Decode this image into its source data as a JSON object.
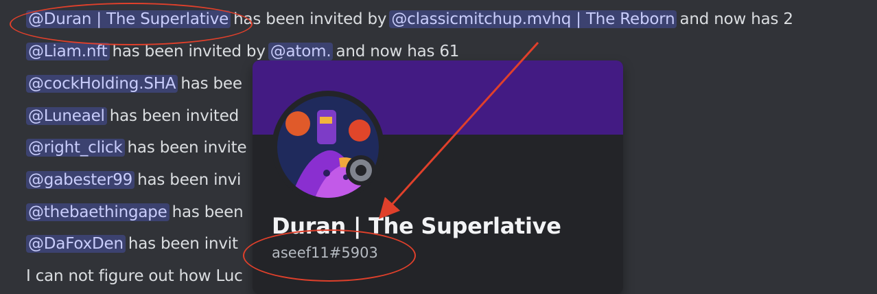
{
  "messages": [
    {
      "mention": "@Duran | The Superlative",
      "text1": "has been invited by",
      "mention2": "@classicmitchup.mvhq | The Reborn",
      "text2": "and now has 2"
    },
    {
      "mention": "@Liam.nft",
      "text1": "has been invited by",
      "mention2": "@atom.",
      "text2": "and now has 61"
    },
    {
      "mention": "@cockHolding.SHA",
      "text1": "has bee"
    },
    {
      "mention": "@Luneael",
      "text1": "has been invited"
    },
    {
      "mention": "@right_click",
      "text1": "has been invite"
    },
    {
      "mention": "@gabester99",
      "text1": "has been invi"
    },
    {
      "mention": "@thebaethingape",
      "text1": "has been"
    },
    {
      "mention": "@DaFoxDen",
      "text1": "has been invit"
    },
    {
      "text1": "I can not figure out how Luc"
    }
  ],
  "popout": {
    "display_name": "Duran | The Superlative",
    "username": "aseef11#5903",
    "banner_color": "#431b83",
    "status": "offline"
  },
  "annotations": {
    "color": "#e0402b"
  }
}
